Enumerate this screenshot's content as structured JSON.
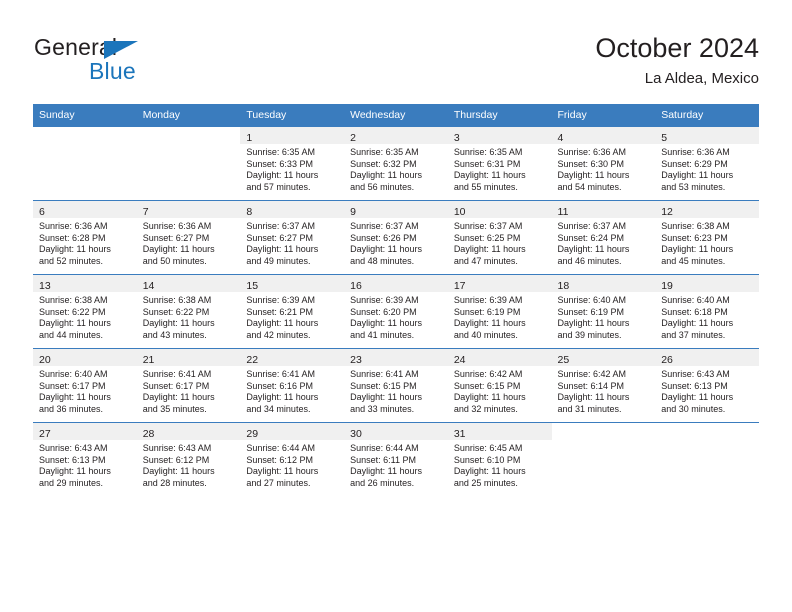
{
  "brand": {
    "name_part1": "General",
    "name_part2": "Blue",
    "flag_icon": "triangle-flag-icon"
  },
  "header": {
    "title": "October 2024",
    "subtitle": "La Aldea, Mexico"
  },
  "colors": {
    "header_blue": "#3a7cbe",
    "brand_blue": "#1b75bb",
    "daynum_strip": "#f0f0f0",
    "text": "#231f20"
  },
  "weekdays": [
    "Sunday",
    "Monday",
    "Tuesday",
    "Wednesday",
    "Thursday",
    "Friday",
    "Saturday"
  ],
  "labels": {
    "sunrise_prefix": "Sunrise: ",
    "sunset_prefix": "Sunset: ",
    "daylight_prefix": "Daylight: "
  },
  "weeks": [
    [
      {
        "day": "",
        "empty": true
      },
      {
        "day": "",
        "empty": true
      },
      {
        "day": "1",
        "sunrise": "Sunrise: 6:35 AM",
        "sunset": "Sunset: 6:33 PM",
        "daylight_l1": "Daylight: 11 hours",
        "daylight_l2": "and 57 minutes."
      },
      {
        "day": "2",
        "sunrise": "Sunrise: 6:35 AM",
        "sunset": "Sunset: 6:32 PM",
        "daylight_l1": "Daylight: 11 hours",
        "daylight_l2": "and 56 minutes."
      },
      {
        "day": "3",
        "sunrise": "Sunrise: 6:35 AM",
        "sunset": "Sunset: 6:31 PM",
        "daylight_l1": "Daylight: 11 hours",
        "daylight_l2": "and 55 minutes."
      },
      {
        "day": "4",
        "sunrise": "Sunrise: 6:36 AM",
        "sunset": "Sunset: 6:30 PM",
        "daylight_l1": "Daylight: 11 hours",
        "daylight_l2": "and 54 minutes."
      },
      {
        "day": "5",
        "sunrise": "Sunrise: 6:36 AM",
        "sunset": "Sunset: 6:29 PM",
        "daylight_l1": "Daylight: 11 hours",
        "daylight_l2": "and 53 minutes."
      }
    ],
    [
      {
        "day": "6",
        "sunrise": "Sunrise: 6:36 AM",
        "sunset": "Sunset: 6:28 PM",
        "daylight_l1": "Daylight: 11 hours",
        "daylight_l2": "and 52 minutes."
      },
      {
        "day": "7",
        "sunrise": "Sunrise: 6:36 AM",
        "sunset": "Sunset: 6:27 PM",
        "daylight_l1": "Daylight: 11 hours",
        "daylight_l2": "and 50 minutes."
      },
      {
        "day": "8",
        "sunrise": "Sunrise: 6:37 AM",
        "sunset": "Sunset: 6:27 PM",
        "daylight_l1": "Daylight: 11 hours",
        "daylight_l2": "and 49 minutes."
      },
      {
        "day": "9",
        "sunrise": "Sunrise: 6:37 AM",
        "sunset": "Sunset: 6:26 PM",
        "daylight_l1": "Daylight: 11 hours",
        "daylight_l2": "and 48 minutes."
      },
      {
        "day": "10",
        "sunrise": "Sunrise: 6:37 AM",
        "sunset": "Sunset: 6:25 PM",
        "daylight_l1": "Daylight: 11 hours",
        "daylight_l2": "and 47 minutes."
      },
      {
        "day": "11",
        "sunrise": "Sunrise: 6:37 AM",
        "sunset": "Sunset: 6:24 PM",
        "daylight_l1": "Daylight: 11 hours",
        "daylight_l2": "and 46 minutes."
      },
      {
        "day": "12",
        "sunrise": "Sunrise: 6:38 AM",
        "sunset": "Sunset: 6:23 PM",
        "daylight_l1": "Daylight: 11 hours",
        "daylight_l2": "and 45 minutes."
      }
    ],
    [
      {
        "day": "13",
        "sunrise": "Sunrise: 6:38 AM",
        "sunset": "Sunset: 6:22 PM",
        "daylight_l1": "Daylight: 11 hours",
        "daylight_l2": "and 44 minutes."
      },
      {
        "day": "14",
        "sunrise": "Sunrise: 6:38 AM",
        "sunset": "Sunset: 6:22 PM",
        "daylight_l1": "Daylight: 11 hours",
        "daylight_l2": "and 43 minutes."
      },
      {
        "day": "15",
        "sunrise": "Sunrise: 6:39 AM",
        "sunset": "Sunset: 6:21 PM",
        "daylight_l1": "Daylight: 11 hours",
        "daylight_l2": "and 42 minutes."
      },
      {
        "day": "16",
        "sunrise": "Sunrise: 6:39 AM",
        "sunset": "Sunset: 6:20 PM",
        "daylight_l1": "Daylight: 11 hours",
        "daylight_l2": "and 41 minutes."
      },
      {
        "day": "17",
        "sunrise": "Sunrise: 6:39 AM",
        "sunset": "Sunset: 6:19 PM",
        "daylight_l1": "Daylight: 11 hours",
        "daylight_l2": "and 40 minutes."
      },
      {
        "day": "18",
        "sunrise": "Sunrise: 6:40 AM",
        "sunset": "Sunset: 6:19 PM",
        "daylight_l1": "Daylight: 11 hours",
        "daylight_l2": "and 39 minutes."
      },
      {
        "day": "19",
        "sunrise": "Sunrise: 6:40 AM",
        "sunset": "Sunset: 6:18 PM",
        "daylight_l1": "Daylight: 11 hours",
        "daylight_l2": "and 37 minutes."
      }
    ],
    [
      {
        "day": "20",
        "sunrise": "Sunrise: 6:40 AM",
        "sunset": "Sunset: 6:17 PM",
        "daylight_l1": "Daylight: 11 hours",
        "daylight_l2": "and 36 minutes."
      },
      {
        "day": "21",
        "sunrise": "Sunrise: 6:41 AM",
        "sunset": "Sunset: 6:17 PM",
        "daylight_l1": "Daylight: 11 hours",
        "daylight_l2": "and 35 minutes."
      },
      {
        "day": "22",
        "sunrise": "Sunrise: 6:41 AM",
        "sunset": "Sunset: 6:16 PM",
        "daylight_l1": "Daylight: 11 hours",
        "daylight_l2": "and 34 minutes."
      },
      {
        "day": "23",
        "sunrise": "Sunrise: 6:41 AM",
        "sunset": "Sunset: 6:15 PM",
        "daylight_l1": "Daylight: 11 hours",
        "daylight_l2": "and 33 minutes."
      },
      {
        "day": "24",
        "sunrise": "Sunrise: 6:42 AM",
        "sunset": "Sunset: 6:15 PM",
        "daylight_l1": "Daylight: 11 hours",
        "daylight_l2": "and 32 minutes."
      },
      {
        "day": "25",
        "sunrise": "Sunrise: 6:42 AM",
        "sunset": "Sunset: 6:14 PM",
        "daylight_l1": "Daylight: 11 hours",
        "daylight_l2": "and 31 minutes."
      },
      {
        "day": "26",
        "sunrise": "Sunrise: 6:43 AM",
        "sunset": "Sunset: 6:13 PM",
        "daylight_l1": "Daylight: 11 hours",
        "daylight_l2": "and 30 minutes."
      }
    ],
    [
      {
        "day": "27",
        "sunrise": "Sunrise: 6:43 AM",
        "sunset": "Sunset: 6:13 PM",
        "daylight_l1": "Daylight: 11 hours",
        "daylight_l2": "and 29 minutes."
      },
      {
        "day": "28",
        "sunrise": "Sunrise: 6:43 AM",
        "sunset": "Sunset: 6:12 PM",
        "daylight_l1": "Daylight: 11 hours",
        "daylight_l2": "and 28 minutes."
      },
      {
        "day": "29",
        "sunrise": "Sunrise: 6:44 AM",
        "sunset": "Sunset: 6:12 PM",
        "daylight_l1": "Daylight: 11 hours",
        "daylight_l2": "and 27 minutes."
      },
      {
        "day": "30",
        "sunrise": "Sunrise: 6:44 AM",
        "sunset": "Sunset: 6:11 PM",
        "daylight_l1": "Daylight: 11 hours",
        "daylight_l2": "and 26 minutes."
      },
      {
        "day": "31",
        "sunrise": "Sunrise: 6:45 AM",
        "sunset": "Sunset: 6:10 PM",
        "daylight_l1": "Daylight: 11 hours",
        "daylight_l2": "and 25 minutes."
      },
      {
        "day": "",
        "empty": true
      },
      {
        "day": "",
        "empty": true
      }
    ]
  ]
}
